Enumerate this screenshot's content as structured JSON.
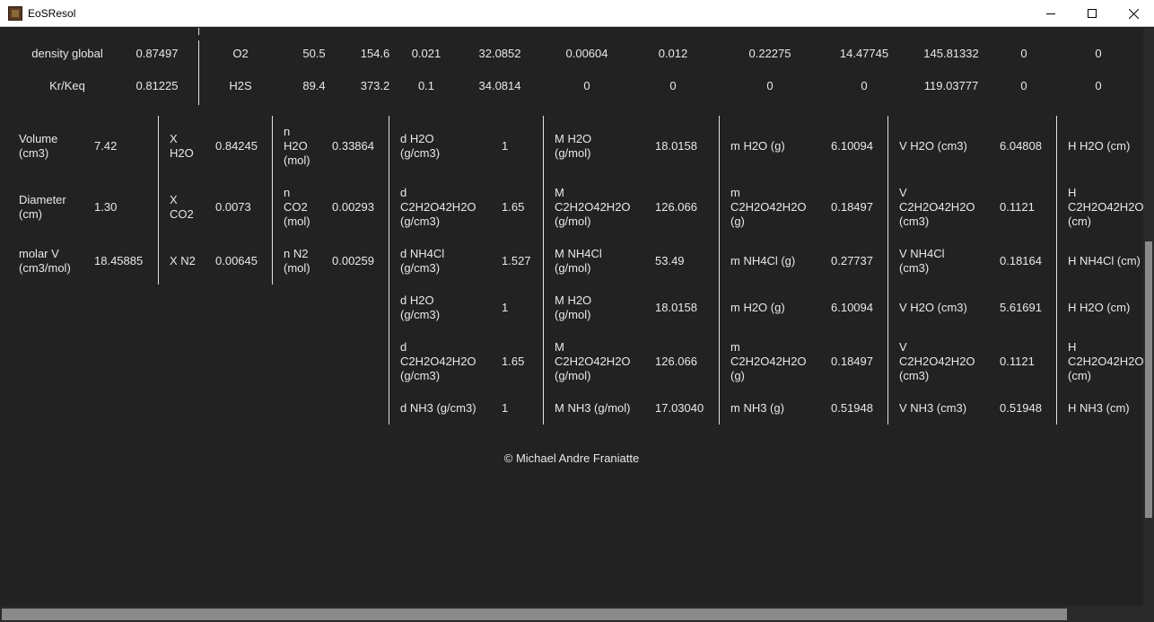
{
  "window": {
    "title": "EoSResol",
    "icon": "app-icon",
    "minimize_icon": "minimize-icon",
    "maximize_icon": "maximize-icon",
    "close_icon": "close-icon"
  },
  "top_rows": [
    [
      "density global",
      "0.87497",
      "O2",
      "50.5",
      "154.6",
      "0.021",
      "32.0852",
      "0.00604",
      "0.012",
      "0.22275",
      "14.47745",
      "145.81332",
      "0",
      "0"
    ],
    [
      "Kr/Keq",
      "0.81225",
      "H2S",
      "89.4",
      "373.2",
      "0.1",
      "34.0814",
      "0",
      "0",
      "0",
      "0",
      "119.03777",
      "0",
      "0"
    ]
  ],
  "left_block": [
    {
      "label": "Volume\n(cm3)",
      "value": "7.42",
      "xlabel": "X\nH2O",
      "xvalue": "0.84245",
      "nlabel": "n\nH2O\n(mol)",
      "nvalue": "0.33864"
    },
    {
      "label": "Diameter\n(cm)",
      "value": "1.30",
      "xlabel": "X\nCO2",
      "xvalue": "0.0073",
      "nlabel": "n\nCO2\n(mol)",
      "nvalue": "0.00293"
    },
    {
      "label": "molar V\n(cm3/mol)",
      "value": "18.45885",
      "xlabel": "X N2",
      "xvalue": "0.00645",
      "nlabel": "n N2\n(mol)",
      "nvalue": "0.00259"
    }
  ],
  "components": [
    {
      "d_label": "d H2O\n(g/cm3)",
      "d_value": "1",
      "M_label": "M H2O\n(g/mol)",
      "M_value": "18.0158",
      "m_label": "m H2O (g)",
      "m_value": "6.10094",
      "V_label": "V H2O (cm3)",
      "V_value": "6.04808",
      "H_label": "H H2O (cm)"
    },
    {
      "d_label": "d\nC2H2O42H2O\n(g/cm3)",
      "d_value": "1.65",
      "M_label": "M\nC2H2O42H2O\n(g/mol)",
      "M_value": "126.066",
      "m_label": "m\nC2H2O42H2O\n(g)",
      "m_value": "0.18497",
      "V_label": "V\nC2H2O42H2O\n(cm3)",
      "V_value": "0.1121",
      "H_label": "H\nC2H2O42H2O\n(cm)"
    },
    {
      "d_label": "d NH4Cl\n(g/cm3)",
      "d_value": "1.527",
      "M_label": "M NH4Cl\n(g/mol)",
      "M_value": "53.49",
      "m_label": "m NH4Cl (g)",
      "m_value": "0.27737",
      "V_label": "V NH4Cl\n(cm3)",
      "V_value": "0.18164",
      "H_label": "H NH4Cl (cm)"
    },
    {
      "d_label": "d H2O\n(g/cm3)",
      "d_value": "1",
      "M_label": "M H2O\n(g/mol)",
      "M_value": "18.0158",
      "m_label": "m H2O (g)",
      "m_value": "6.10094",
      "V_label": "V H2O (cm3)",
      "V_value": "5.61691",
      "H_label": "H H2O (cm)"
    },
    {
      "d_label": "d\nC2H2O42H2O\n(g/cm3)",
      "d_value": "1.65",
      "M_label": "M\nC2H2O42H2O\n(g/mol)",
      "M_value": "126.066",
      "m_label": "m\nC2H2O42H2O\n(g)",
      "m_value": "0.18497",
      "V_label": "V\nC2H2O42H2O\n(cm3)",
      "V_value": "0.1121",
      "H_label": "H\nC2H2O42H2O\n(cm)"
    },
    {
      "d_label": "d NH3 (g/cm3)",
      "d_value": "1",
      "M_label": "M NH3 (g/mol)",
      "M_value": "17.03040",
      "m_label": "m NH3 (g)",
      "m_value": "0.51948",
      "V_label": "V NH3 (cm3)",
      "V_value": "0.51948",
      "H_label": "H NH3 (cm)"
    }
  ],
  "copyright": "© Michael Andre Franiatte",
  "colors": {
    "background": "#222222",
    "text": "#e8e8e8",
    "separator": "#e0e0e0",
    "titlebar": "#ffffff",
    "scroll_thumb": "#8a8a8a"
  }
}
